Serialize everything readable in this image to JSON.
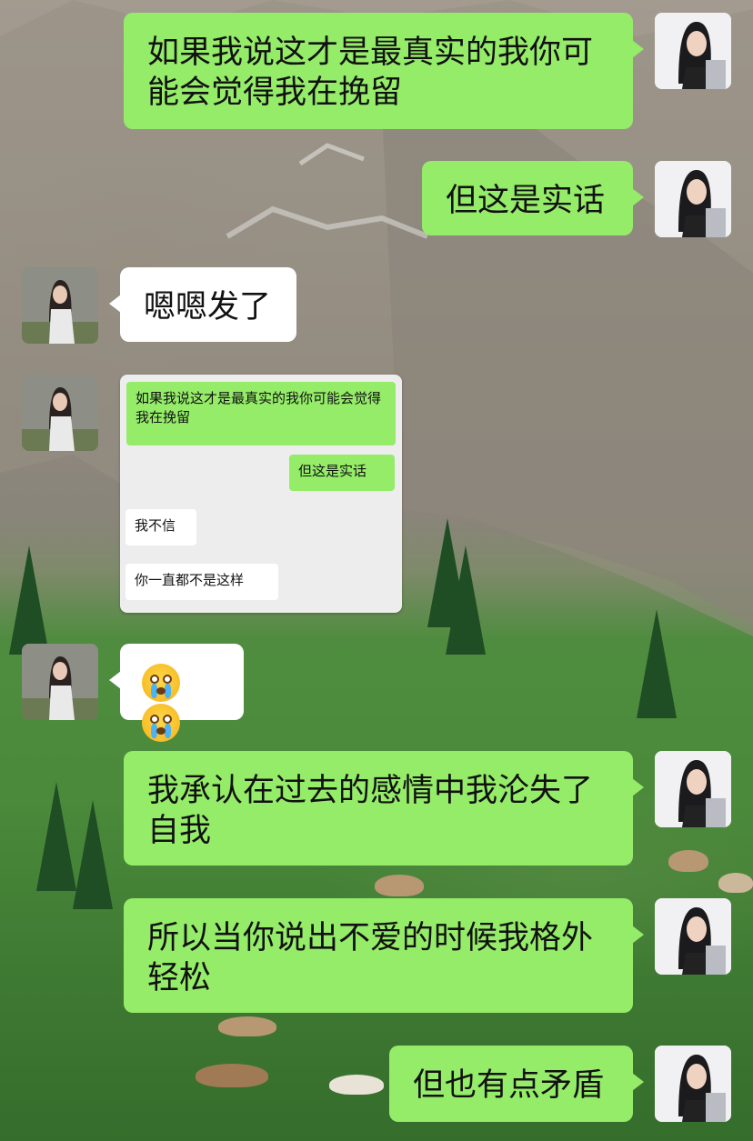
{
  "messages": [
    {
      "side": "me",
      "text": "如果我说这才是最真实的我你可能会觉得我在挽留"
    },
    {
      "side": "me",
      "text": "但这是实话"
    },
    {
      "side": "them",
      "text": "嗯嗯发了"
    },
    {
      "side": "them",
      "type": "screenshot",
      "embedded": [
        {
          "side": "me",
          "text": "如果我说这才是最真实的我你可能会觉得我在挽留"
        },
        {
          "side": "me",
          "text": "但这是实话"
        },
        {
          "side": "them",
          "text": "我不信"
        },
        {
          "side": "them",
          "text": "你一直都不是这样"
        }
      ]
    },
    {
      "side": "them",
      "type": "emoji",
      "emojis": [
        "crying-face-icon",
        "crying-face-icon"
      ]
    },
    {
      "side": "me",
      "text": "我承认在过去的感情中我沦失了自我"
    },
    {
      "side": "me",
      "text": "所以当你说出不爱的时候我格外轻松"
    },
    {
      "side": "me",
      "text": "但也有点矛盾"
    }
  ],
  "colors": {
    "my_bubble": "#95ec69",
    "their_bubble": "#ffffff"
  }
}
